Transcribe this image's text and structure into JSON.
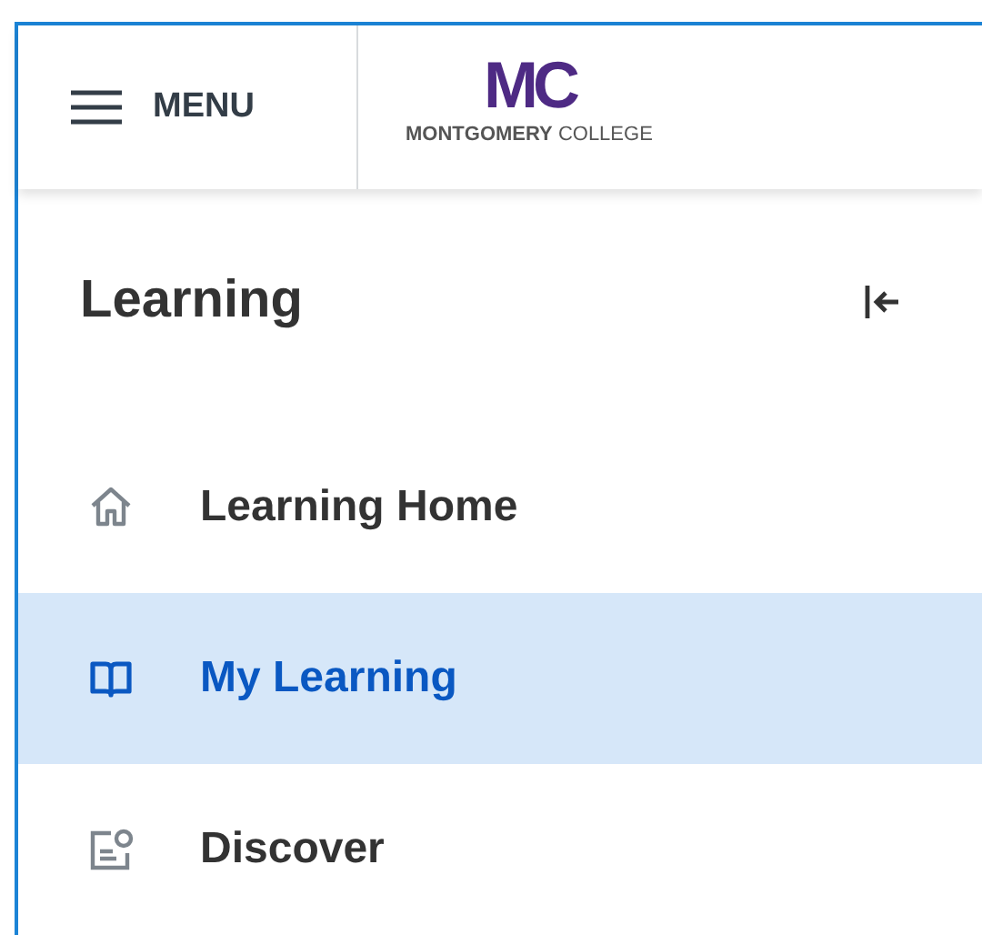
{
  "header": {
    "menu_label": "MENU",
    "logo": {
      "mark": "MC",
      "name_bold": "MONTGOMERY",
      "name_light": "COLLEGE"
    }
  },
  "sidebar": {
    "title": "Learning",
    "items": [
      {
        "label": "Learning Home",
        "kind": "home",
        "selected": false
      },
      {
        "label": "My Learning",
        "kind": "book",
        "selected": true
      },
      {
        "label": "Discover",
        "kind": "discover",
        "selected": false
      }
    ]
  }
}
